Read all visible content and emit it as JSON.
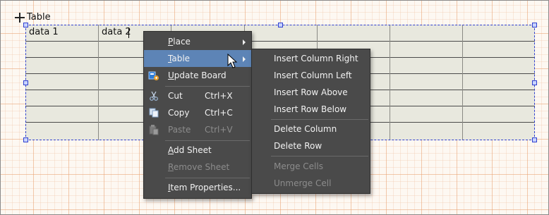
{
  "table": {
    "title": "Table",
    "cells": [
      "data 1",
      "data 2"
    ]
  },
  "context_menu": {
    "items": [
      {
        "label": "Place",
        "has_submenu": true
      },
      {
        "label": "Table",
        "has_submenu": true,
        "highlighted": true
      },
      {
        "label": "Update Board",
        "icon": "update-board-icon"
      },
      {
        "label": "Cut",
        "shortcut": "Ctrl+X",
        "icon": "scissors-icon"
      },
      {
        "label": "Copy",
        "shortcut": "Ctrl+C",
        "icon": "copy-icon"
      },
      {
        "label": "Paste",
        "shortcut": "Ctrl+V",
        "icon": "paste-icon",
        "disabled": true
      },
      {
        "label": "Add Sheet"
      },
      {
        "label": "Remove Sheet",
        "disabled": true
      },
      {
        "label": "Item Properties..."
      }
    ]
  },
  "table_submenu": {
    "items": [
      {
        "label": "Insert Column Right"
      },
      {
        "label": "Insert Column Left"
      },
      {
        "label": "Insert Row Above"
      },
      {
        "label": "Insert Row Below"
      },
      {
        "label": "Delete Column"
      },
      {
        "label": "Delete Row"
      },
      {
        "label": "Merge Cells",
        "disabled": true
      },
      {
        "label": "Unmerge Cell",
        "disabled": true
      }
    ]
  },
  "colors": {
    "menu_bg": "#4a4a4a",
    "highlight": "#5d84b6",
    "selection": "#3040d0",
    "table_bg": "#e8e8de"
  }
}
